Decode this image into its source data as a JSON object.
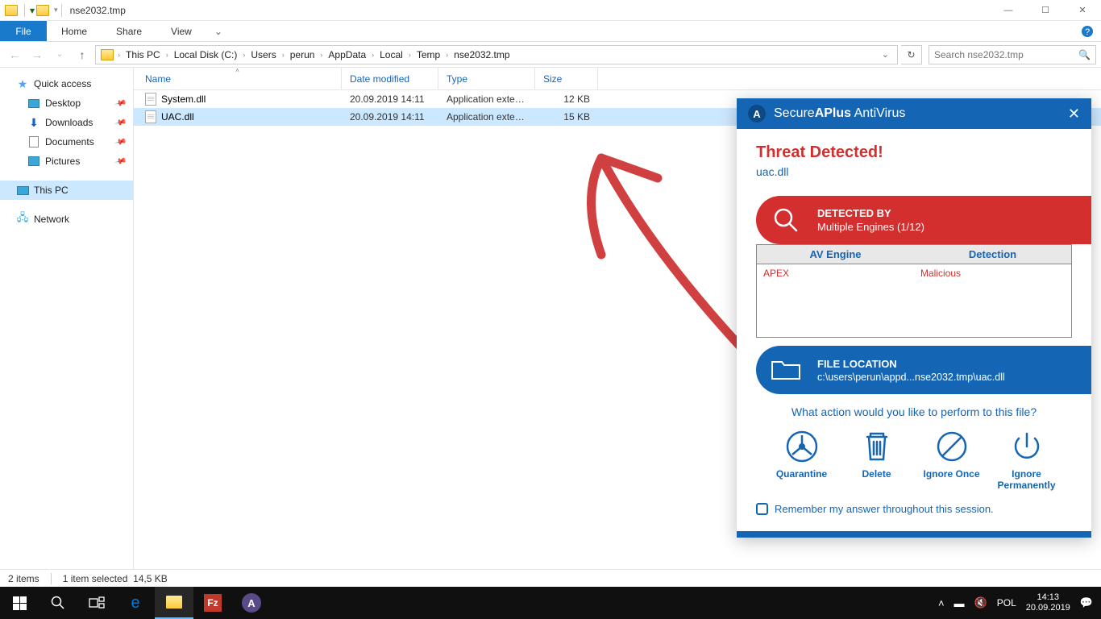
{
  "title": "nse2032.tmp",
  "ribbon": {
    "file": "File",
    "home": "Home",
    "share": "Share",
    "view": "View"
  },
  "breadcrumb": [
    "This PC",
    "Local Disk (C:)",
    "Users",
    "perun",
    "AppData",
    "Local",
    "Temp",
    "nse2032.tmp"
  ],
  "search_placeholder": "Search nse2032.tmp",
  "sidebar": {
    "quick": "Quick access",
    "desktop": "Desktop",
    "downloads": "Downloads",
    "documents": "Documents",
    "pictures": "Pictures",
    "thispc": "This PC",
    "network": "Network"
  },
  "columns": {
    "name": "Name",
    "date": "Date modified",
    "type": "Type",
    "size": "Size"
  },
  "files": [
    {
      "name": "System.dll",
      "date": "20.09.2019 14:11",
      "type": "Application extens...",
      "size": "12 KB",
      "selected": false
    },
    {
      "name": "UAC.dll",
      "date": "20.09.2019 14:11",
      "type": "Application extens...",
      "size": "15 KB",
      "selected": true
    }
  ],
  "status": {
    "items": "2 items",
    "selected": "1 item selected",
    "size": "14,5 KB"
  },
  "popup": {
    "brand1": "Secure",
    "brand2": "APlus",
    "brand3": " AntiVirus",
    "threat": "Threat Detected!",
    "file": "uac.dll",
    "detected_by": "DETECTED BY",
    "engines": "Multiple Engines (1/12)",
    "col_engine": "AV Engine",
    "col_detection": "Detection",
    "engine": "APEX",
    "detection": "Malicious",
    "floc_h": "FILE LOCATION",
    "floc_p": "c:\\users\\perun\\appd...nse2032.tmp\\uac.dll",
    "question": "What action would you like to perform to this file?",
    "a_quarantine": "Quarantine",
    "a_delete": "Delete",
    "a_ignore_once": "Ignore Once",
    "a_ignore_perm": "Ignore Permanently",
    "remember": "Remember my answer throughout this session."
  },
  "taskbar": {
    "lang": "POL",
    "time": "14:13",
    "date": "20.09.2019"
  }
}
